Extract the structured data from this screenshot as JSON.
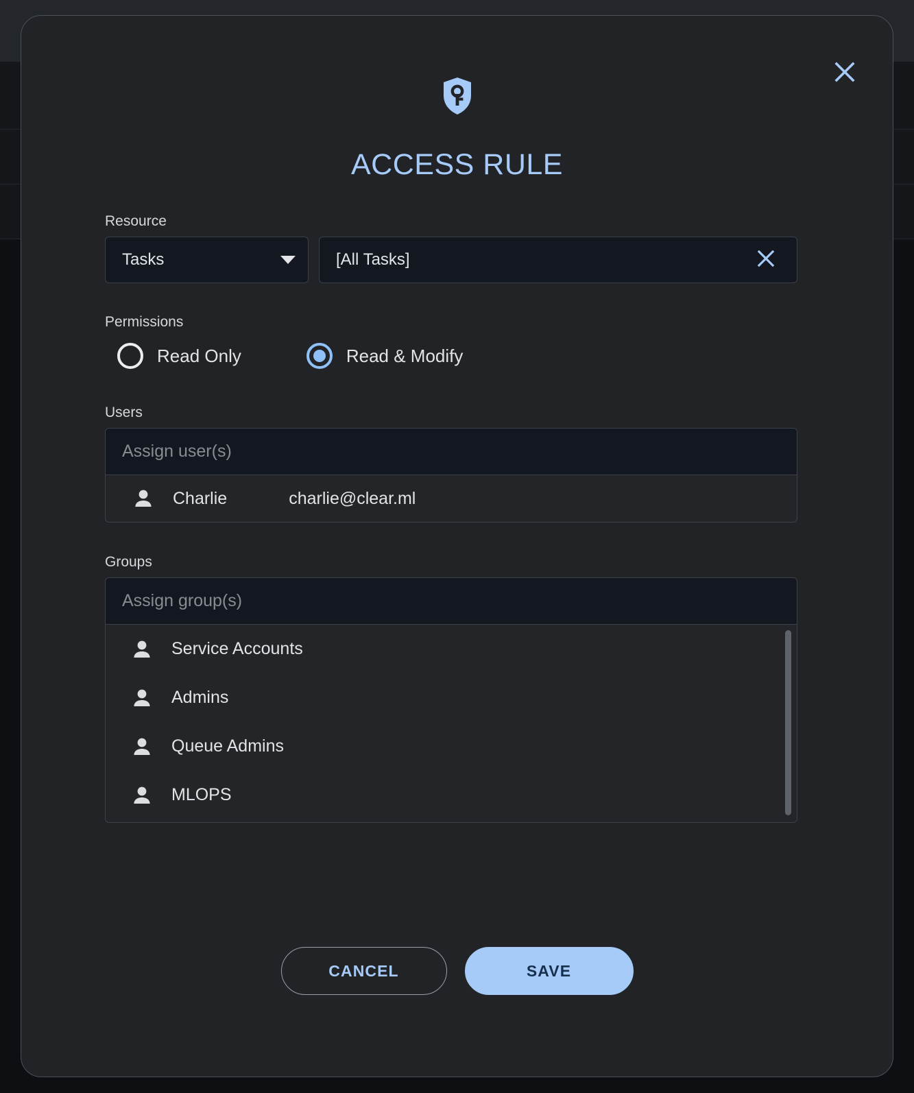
{
  "modal": {
    "title": "ACCESS RULE",
    "header_icon": "shield-key-icon",
    "close_icon": "close-icon",
    "accent_color": "#a7cbf8",
    "background_color": "#212326"
  },
  "resource": {
    "label": "Resource",
    "type_select": {
      "value": "Tasks",
      "icon": "chevron-down-icon"
    },
    "scope_field": {
      "value": "[All Tasks]",
      "clear_icon": "close-icon"
    }
  },
  "permissions": {
    "label": "Permissions",
    "options": [
      {
        "label": "Read Only",
        "selected": false
      },
      {
        "label": "Read & Modify",
        "selected": true
      }
    ]
  },
  "users": {
    "label": "Users",
    "placeholder": "Assign user(s)",
    "rows": [
      {
        "icon": "person-icon",
        "name": "Charlie",
        "email": "charlie@clear.ml"
      }
    ]
  },
  "groups": {
    "label": "Groups",
    "placeholder": "Assign group(s)",
    "rows": [
      {
        "icon": "person-icon",
        "name": "Service Accounts"
      },
      {
        "icon": "person-icon",
        "name": "Admins"
      },
      {
        "icon": "person-icon",
        "name": "Queue Admins"
      },
      {
        "icon": "person-icon",
        "name": "MLOPS"
      }
    ]
  },
  "footer": {
    "cancel_label": "CANCEL",
    "save_label": "SAVE"
  }
}
